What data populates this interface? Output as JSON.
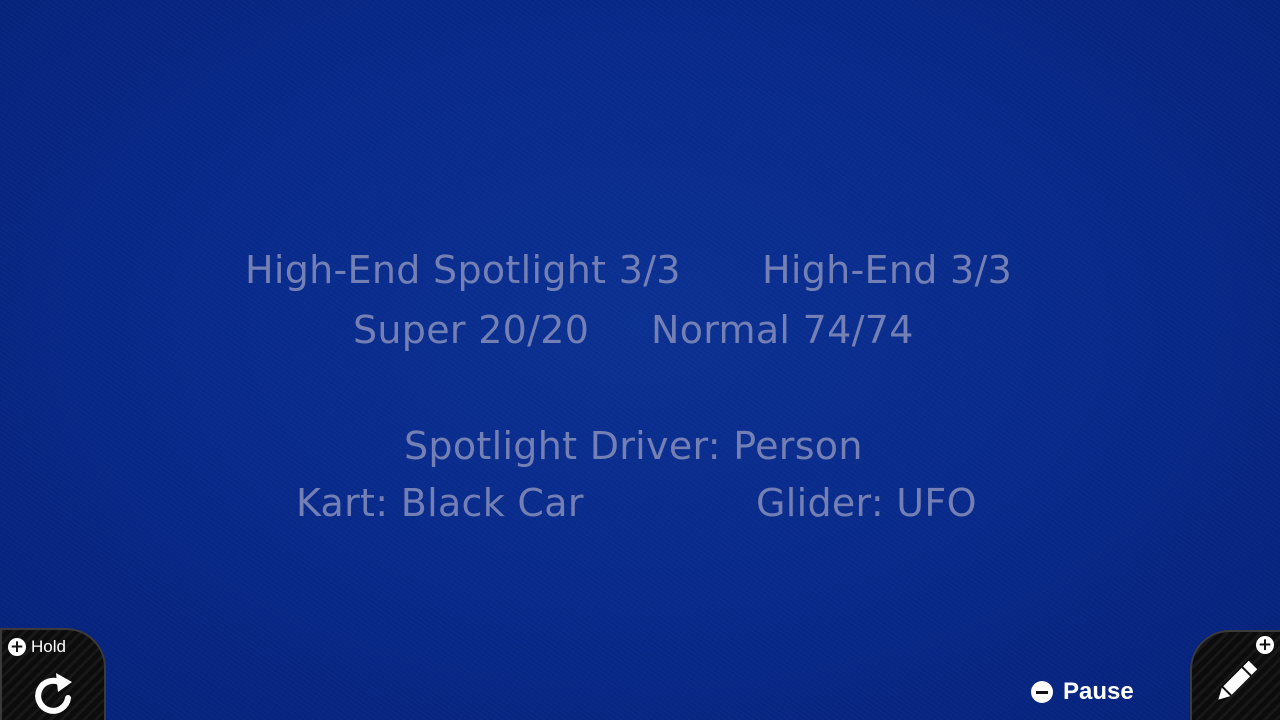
{
  "stats": {
    "high_end_spotlight": "High-End Spotlight 3/3",
    "high_end": "High-End 3/3",
    "super": "Super 20/20",
    "normal": "Normal 74/74"
  },
  "details": {
    "spotlight_driver": "Spotlight Driver: Person",
    "kart": "Kart: Black Car",
    "glider": "Glider: UFO"
  },
  "controls": {
    "hold_label": "Hold",
    "hold_badge": "+",
    "hold_icon": "rotate-icon",
    "pause_label": "Pause",
    "pause_icon": "minus-icon",
    "edit_badge": "+",
    "edit_icon": "pencil-icon"
  },
  "colors": {
    "background": "#08298a",
    "info_text": "#7480b4",
    "control_text": "#ffffff"
  }
}
